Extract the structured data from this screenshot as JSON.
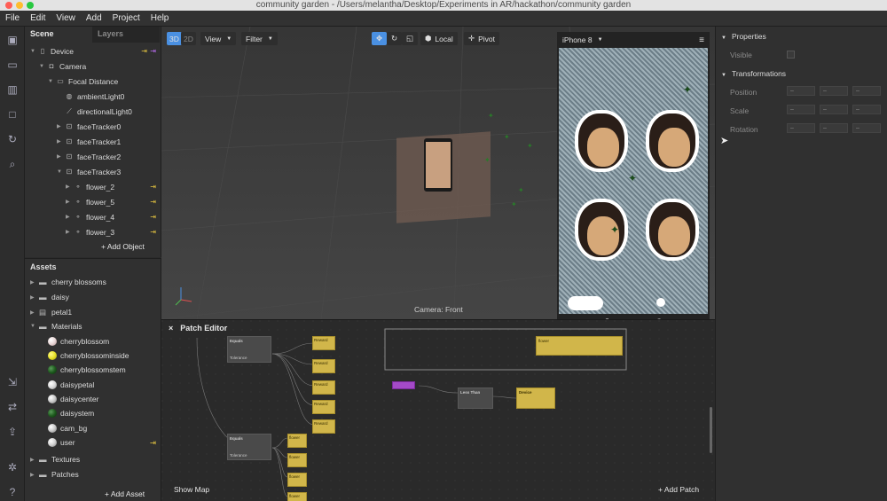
{
  "window": {
    "title": "community garden - /Users/melantha/Desktop/Experiments in AR/hackathon/community garden"
  },
  "menu": [
    "File",
    "Edit",
    "View",
    "Add",
    "Project",
    "Help"
  ],
  "scene": {
    "tabs": [
      "Scene",
      "Layers"
    ],
    "items": [
      {
        "label": "Device",
        "depth": 0,
        "icon": "device"
      },
      {
        "label": "Camera",
        "depth": 1,
        "icon": "camera"
      },
      {
        "label": "Focal Distance",
        "depth": 2,
        "icon": "focal"
      },
      {
        "label": "ambientLight0",
        "depth": 3,
        "icon": "light"
      },
      {
        "label": "directionalLight0",
        "depth": 3,
        "icon": "light"
      },
      {
        "label": "faceTracker0",
        "depth": 3,
        "icon": "tracker"
      },
      {
        "label": "faceTracker1",
        "depth": 3,
        "icon": "tracker"
      },
      {
        "label": "faceTracker2",
        "depth": 3,
        "icon": "tracker"
      },
      {
        "label": "faceTracker3",
        "depth": 3,
        "icon": "tracker"
      },
      {
        "label": "flower_2",
        "depth": 4,
        "icon": "object"
      },
      {
        "label": "flower_5",
        "depth": 4,
        "icon": "object"
      },
      {
        "label": "flower_4",
        "depth": 4,
        "icon": "object"
      },
      {
        "label": "flower_3",
        "depth": 4,
        "icon": "object"
      }
    ],
    "add_object": "Add Object"
  },
  "assets": {
    "title": "Assets",
    "items": [
      {
        "label": "cherry blossoms",
        "type": "folder"
      },
      {
        "label": "daisy",
        "type": "folder"
      },
      {
        "label": "petal1",
        "type": "file"
      },
      {
        "label": "Materials",
        "type": "folder-open"
      },
      {
        "label": "cherryblossom",
        "type": "material",
        "color": "#e8d6d6"
      },
      {
        "label": "cherryblossominside",
        "type": "material",
        "color": "#e8e22a"
      },
      {
        "label": "cherryblossomstem",
        "type": "material",
        "color": "#1e5a1e"
      },
      {
        "label": "daisypetal",
        "type": "material",
        "color": "#d8d8d8"
      },
      {
        "label": "daisycenter",
        "type": "material",
        "color": "#c8c8c8"
      },
      {
        "label": "daisystem",
        "type": "material",
        "color": "#1e5a1e"
      },
      {
        "label": "cam_bg",
        "type": "material",
        "color": "#c8c8c8"
      },
      {
        "label": "user",
        "type": "material",
        "color": "#d0d0d0"
      },
      {
        "label": "Textures",
        "type": "folder"
      },
      {
        "label": "Patches",
        "type": "folder"
      }
    ],
    "add_asset": "Add Asset"
  },
  "viewport": {
    "mode3d": "3D",
    "mode2d": "2D",
    "view": "View",
    "filter": "Filter",
    "local": "Local",
    "pivot": "Pivot",
    "camera_label": "Camera: Front"
  },
  "phone": {
    "device": "iPhone 8"
  },
  "properties": {
    "title": "Properties",
    "visible": "Visible",
    "transformations": "Transformations",
    "rows": [
      "Position",
      "Scale",
      "Rotation"
    ]
  },
  "patch": {
    "title": "Patch Editor",
    "show_map": "Show Map",
    "add_patch": "Add Patch",
    "nodes": {
      "equals": "Equals",
      "tolerance": "Tolerance",
      "less_than": "Less Than",
      "device": "Device",
      "reward": "Reward",
      "flower": "flower"
    }
  },
  "colors": {
    "accent": "#4a90e2",
    "node_yellow": "#d1b64a",
    "node_purple": "#a44ac8"
  }
}
